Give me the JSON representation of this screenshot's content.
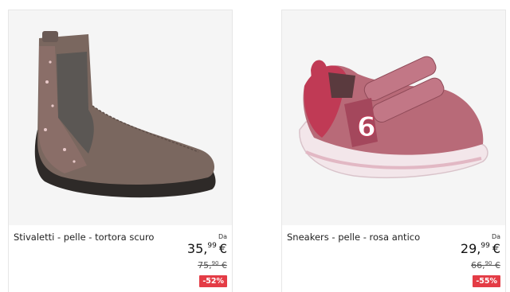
{
  "products": [
    {
      "name": "Stivaletti - pelle - tortora scuro",
      "from_label": "Da",
      "price_int": "35,",
      "price_dec": "99",
      "currency": "€",
      "old_int": "75,",
      "old_dec": "90",
      "old_currency": " €",
      "discount": "-52%",
      "image_icon": "ankle-boot-image"
    },
    {
      "name": "Sneakers - pelle - rosa antico",
      "from_label": "Da",
      "price_int": "29,",
      "price_dec": "99",
      "currency": "€",
      "old_int": "66,",
      "old_dec": "90",
      "old_currency": " €",
      "discount": "-55%",
      "image_icon": "sneaker-image"
    }
  ],
  "colors": {
    "badge": "#e43c46",
    "boot": "#7a675f",
    "sneaker": "#b86a78"
  }
}
